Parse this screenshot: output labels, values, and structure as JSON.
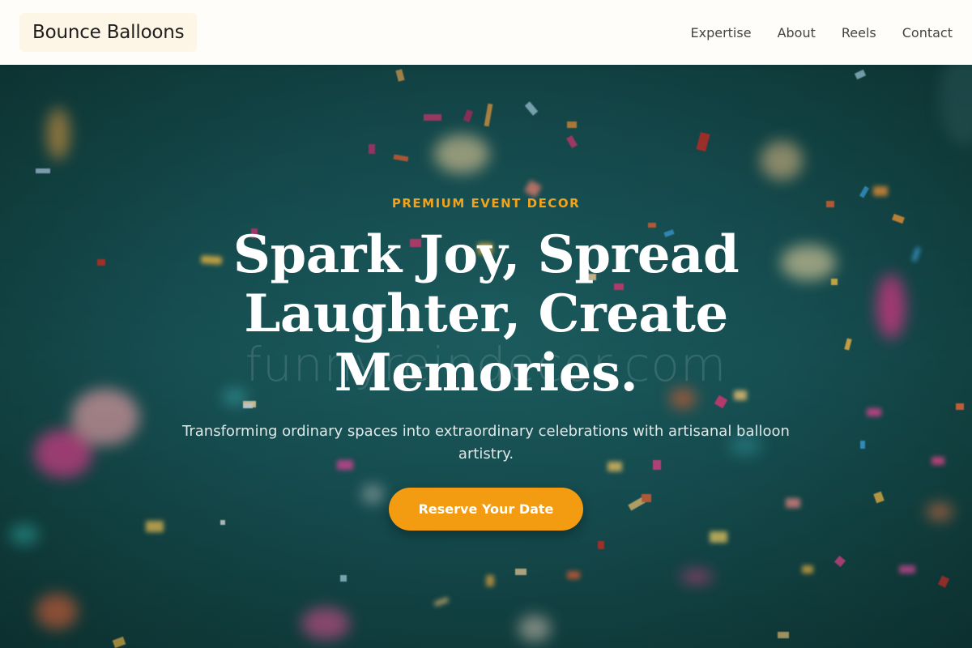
{
  "brand": {
    "name": "Bounce Balloons"
  },
  "nav": {
    "items": [
      "Expertise",
      "About",
      "Reels",
      "Contact"
    ]
  },
  "hero": {
    "eyebrow": "PREMIUM EVENT DECOR",
    "headline": "Spark Joy, Spread Laughter, Create Memories.",
    "subtitle": "Transforming ordinary spaces into extraordinary celebrations with artisanal balloon artistry.",
    "cta_label": "Reserve Your Date",
    "watermark": "funnyreindecor.com",
    "background_image": "confetti-on-teal-background"
  },
  "colors": {
    "accent": "#f39c12",
    "eyebrow": "#f2a31b",
    "hero_bg": "#195659",
    "header_bg": "#fffdf9"
  }
}
